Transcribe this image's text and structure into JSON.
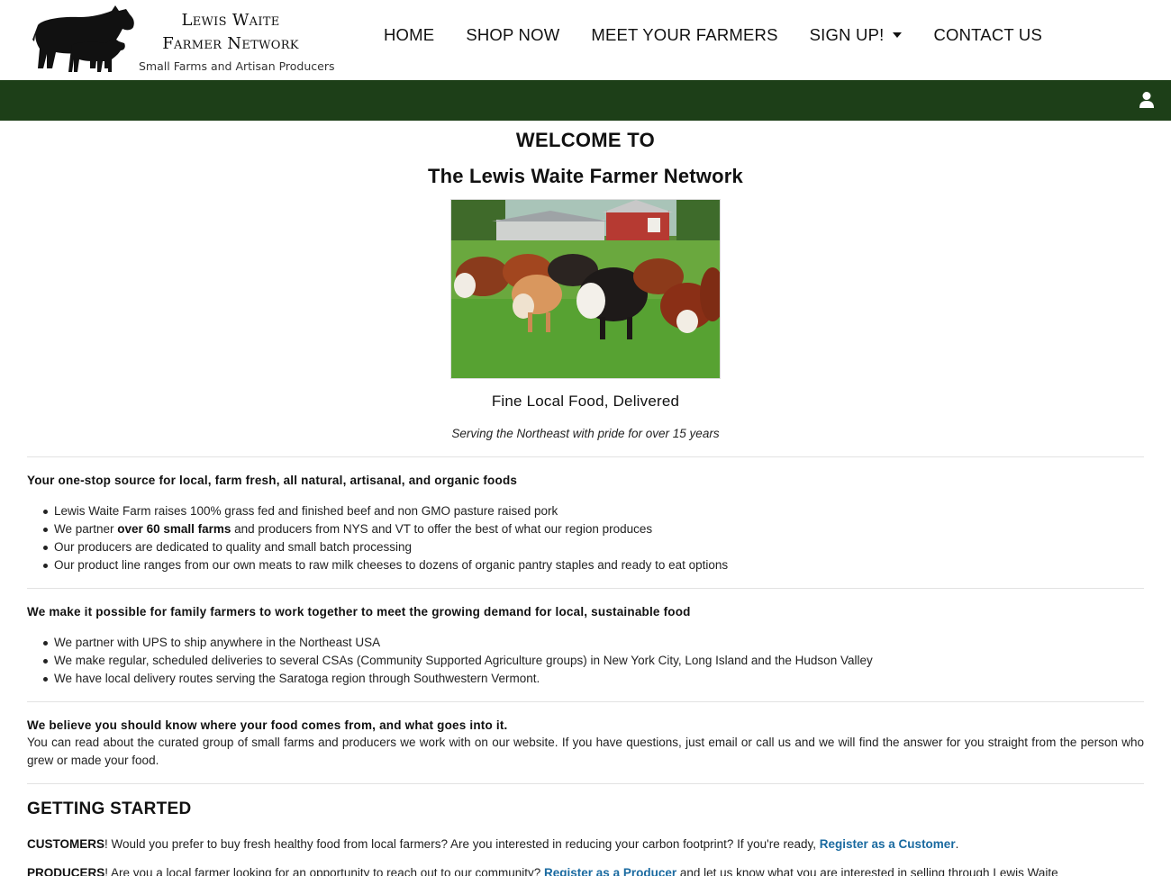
{
  "header": {
    "logo_line1": "Lewis Waite",
    "logo_line2": "Farmer Network",
    "logo_tagline": "Small Farms and Artisan Producers",
    "nav": [
      {
        "label": "HOME"
      },
      {
        "label": "SHOP NOW"
      },
      {
        "label": "MEET YOUR FARMERS"
      },
      {
        "label": "SIGN UP!"
      },
      {
        "label": "CONTACT US"
      }
    ]
  },
  "colors": {
    "green_bar": "#1d3f18",
    "link": "#1a6aa0"
  },
  "icons": {
    "user": "user-icon",
    "signup_dropdown": "caret-down-icon",
    "logo": "cow-silhouette-icon"
  },
  "hero": {
    "welcome": "WELCOME TO",
    "title": "The Lewis Waite Farmer Network",
    "tagline": "Fine Local Food, Delivered",
    "subtitle": "Serving the Northeast with pride for over 15 years"
  },
  "section1": {
    "title": "Your one-stop source for local, farm fresh, all natural, artisanal, and organic foods",
    "bullet1": "Lewis Waite Farm raises 100% grass fed and finished beef and non GMO pasture raised pork",
    "bullet2_pre": "We partner ",
    "bullet2_bold": "over 60 small farms",
    "bullet2_post": " and producers from NYS and VT to offer the best of what our region produces",
    "bullet3": "Our producers are dedicated to quality and small batch processing",
    "bullet4": "Our product line ranges from our own meats to raw milk cheeses to dozens of organic pantry staples and ready to eat options"
  },
  "section2": {
    "title": "We make it possible for family farmers to work together to meet the growing demand for local, sustainable food",
    "bullet1": "We partner with UPS to ship anywhere in the Northeast USA",
    "bullet2": "We make regular, scheduled deliveries to several CSAs (Community Supported Agriculture groups) in New York City, Long Island and the Hudson Valley",
    "bullet3": "We have local delivery routes serving the Saratoga region through Southwestern Vermont."
  },
  "section3": {
    "title": "We believe you should know where your food comes from, and what goes into it.",
    "body": "You can read about the curated group of small farms and producers we work with on our website. If you have questions, just email or call us and we will find the answer for you straight from the person who grew or made your food."
  },
  "getting_started": {
    "heading": "GETTING STARTED",
    "customers_label": "CUSTOMERS",
    "customers_text": "! Would you prefer to buy fresh healthy food from local farmers? Are you interested in reducing your carbon footprint? If you're ready, ",
    "customers_link": "Register as a Customer",
    "customers_end": ".",
    "producers_label": "PRODUCERS",
    "producers_text": "! Are you a local farmer looking for an opportunity to reach out to our community? ",
    "producers_link": "Register as a Producer",
    "producers_end": " and let us know what you are interested in selling through Lewis Waite"
  }
}
